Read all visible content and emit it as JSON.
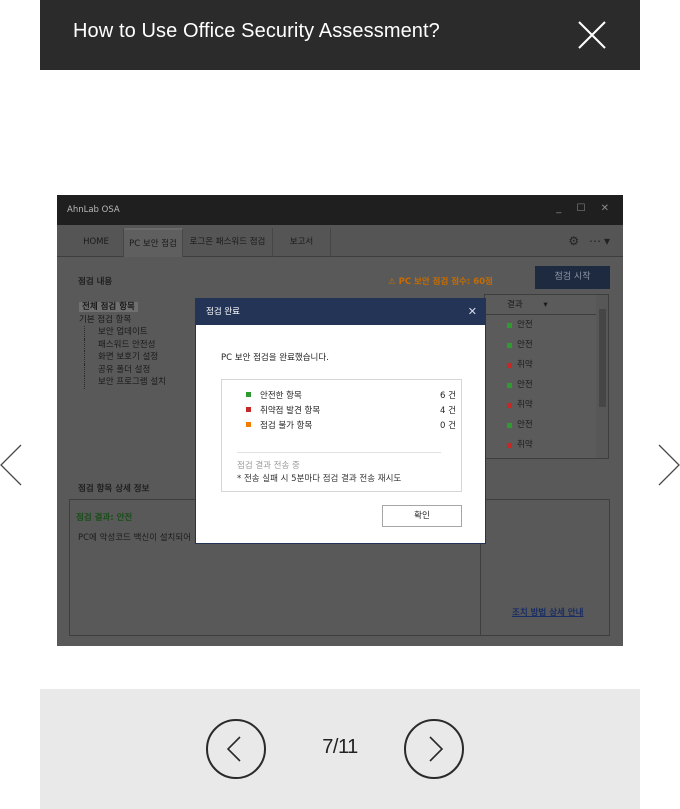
{
  "header": {
    "title": "How to Use Office Security Assessment?"
  },
  "pager": {
    "current": "7/11"
  },
  "app": {
    "name": "AhnLab OSA",
    "tabs": [
      "HOME",
      "PC 보안 점검",
      "로그온 패스워드 점검",
      "보고서"
    ],
    "check_contents_label": "점검 내용",
    "score_warning": "PC 보안 점검 점수: 60점",
    "start_button": "점검 시작",
    "tree": {
      "all": "전체 점검 항목",
      "basic": "기본 점검 항목",
      "children": [
        "보안 업데이트",
        "패스워드 안전성",
        "화면 보호기 설정",
        "공유 폴더 설정",
        "보안 프로그램 설치"
      ]
    },
    "result_header": "결과",
    "results": [
      {
        "label": "안전",
        "color": "#2f9a2f"
      },
      {
        "label": "안전",
        "color": "#2f9a2f"
      },
      {
        "label": "취약",
        "color": "#c62828"
      },
      {
        "label": "안전",
        "color": "#2f9a2f"
      },
      {
        "label": "취약",
        "color": "#c62828"
      },
      {
        "label": "안전",
        "color": "#2f9a2f"
      },
      {
        "label": "취약",
        "color": "#c62828"
      }
    ],
    "detail_label": "점검 항목 상세 정보",
    "detail_result": "점검 결과: 안전",
    "detail_text": "PC에 악성코드 백신이 설치되어",
    "guide_link": "조치 방법 상세 안내"
  },
  "dialog": {
    "title": "점검 완료",
    "message": "PC 보안 점검을 완료했습니다.",
    "rows": [
      {
        "label": "안전한 항목",
        "count": "6 건",
        "color": "#2f9a2f"
      },
      {
        "label": "취약점 발견 항목",
        "count": "4 건",
        "color": "#c62828"
      },
      {
        "label": "점검 불가 항목",
        "count": "0 건",
        "color": "#ef7d00"
      }
    ],
    "note_status": "점검 결과 전송 중",
    "note_retry": "* 전송 실패 시 5분마다 점검 결과 전송 재시도",
    "ok": "확인"
  }
}
